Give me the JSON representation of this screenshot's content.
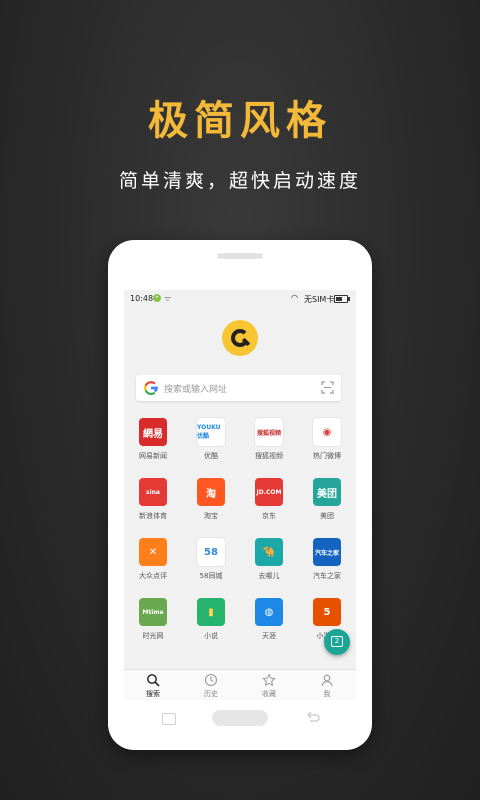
{
  "headline": "极简风格",
  "subline": "简单清爽，超快启动速度",
  "status": {
    "time": "10:48",
    "sim": "无SIM卡",
    "battery_level": 0.6
  },
  "search": {
    "placeholder": "搜索或输入网址"
  },
  "colors": {
    "accent": "#f4b938",
    "logo_yellow": "#f7c531",
    "fab": "#1aa596"
  },
  "sites": [
    {
      "label": "网易新闻",
      "icon_text": "網易",
      "bg": "#d82c2c",
      "fg": "#ffffff"
    },
    {
      "label": "优酷",
      "icon_text": "YOUKU优酷",
      "bg": "#ffffff",
      "fg": "#1e88e5"
    },
    {
      "label": "搜狐视频",
      "icon_text": "搜狐视频",
      "bg": "#ffffff",
      "fg": "#c62828"
    },
    {
      "label": "热门微博",
      "icon_text": "◉",
      "bg": "#ffffff",
      "fg": "#e53935"
    },
    {
      "label": "新浪体育",
      "icon_text": "sina",
      "bg": "#e53935",
      "fg": "#ffffff"
    },
    {
      "label": "淘宝",
      "icon_text": "淘",
      "bg": "#ff5722",
      "fg": "#ffffff"
    },
    {
      "label": "京东",
      "icon_text": "JD.COM",
      "bg": "#e53935",
      "fg": "#ffffff"
    },
    {
      "label": "美团",
      "icon_text": "美团",
      "bg": "#26a69a",
      "fg": "#ffffff"
    },
    {
      "label": "大众点评",
      "icon_text": "✕",
      "bg": "#ff7f1a",
      "fg": "#ffffff"
    },
    {
      "label": "58同城",
      "icon_text": "58",
      "bg": "#ffffff",
      "fg": "#2e8bde"
    },
    {
      "label": "去哪儿",
      "icon_text": "🐪",
      "bg": "#1aa8a8",
      "fg": "#ffffff"
    },
    {
      "label": "汽车之家",
      "icon_text": "汽车之家",
      "bg": "#1565c0",
      "fg": "#ffffff"
    },
    {
      "label": "时光网",
      "icon_text": "Mtime",
      "bg": "#6aa84f",
      "fg": "#ffffff"
    },
    {
      "label": "小说",
      "icon_text": "▮",
      "bg": "#26b36b",
      "fg": "#ffd54f"
    },
    {
      "label": "天涯",
      "icon_text": "◍",
      "bg": "#1e88e5",
      "fg": "#ffffff"
    },
    {
      "label": "小游戏",
      "icon_text": "5",
      "bg": "#e65100",
      "fg": "#ffffff"
    }
  ],
  "tabs": [
    {
      "label": "搜索",
      "icon": "search-icon",
      "active": true
    },
    {
      "label": "历史",
      "icon": "clock-icon",
      "active": false
    },
    {
      "label": "收藏",
      "icon": "star-icon",
      "active": false
    },
    {
      "label": "我",
      "icon": "person-icon",
      "active": false
    }
  ],
  "fab": {
    "icon": "calendar-icon",
    "text": "2"
  },
  "pager": {
    "count": 2,
    "active": 1
  }
}
